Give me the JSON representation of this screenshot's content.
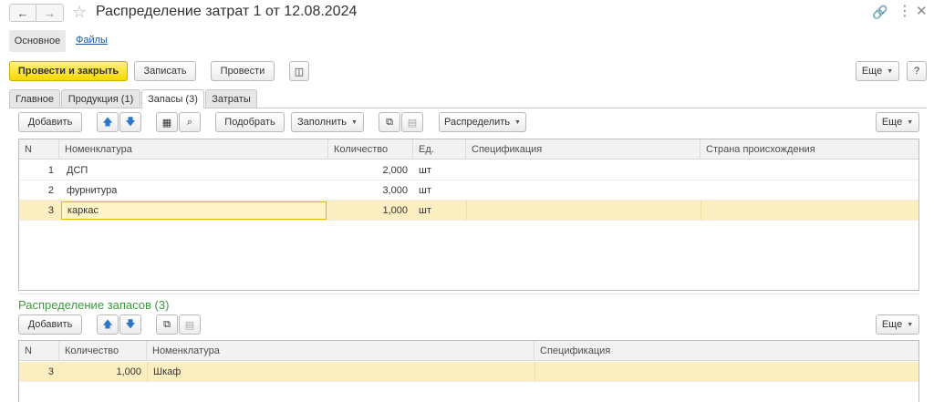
{
  "window": {
    "title": "Распределение затрат 1 от 12.08.2024",
    "icons": [
      "back-arrow-icon",
      "forward-arrow-icon",
      "star-icon",
      "link-icon",
      "more-vertical-icon",
      "close-icon"
    ]
  },
  "sections": {
    "main": "Основное",
    "files": "Файлы"
  },
  "toolbar": {
    "post_close": "Провести и закрыть",
    "save": "Записать",
    "post": "Провести",
    "more": "Еще",
    "help": "?"
  },
  "tabs": [
    "Главное",
    "Продукция (1)",
    "Запасы (3)",
    "Затраты"
  ],
  "stock_toolbar": {
    "add": "Добавить",
    "select": "Подобрать",
    "fill": "Заполнить",
    "distribute": "Распределить",
    "more": "Еще"
  },
  "stock_table": {
    "columns": [
      "N",
      "Номенклатура",
      "Количество",
      "Ед.",
      "Спецификация",
      "Страна происхождения"
    ],
    "rows": [
      {
        "n": "1",
        "item": "ДСП",
        "qty": "2,000",
        "unit": "шт"
      },
      {
        "n": "2",
        "item": "фурнитура",
        "qty": "3,000",
        "unit": "шт"
      },
      {
        "n": "3",
        "item": "каркас",
        "qty": "1,000",
        "unit": "шт"
      }
    ]
  },
  "dist": {
    "title": "Распределение запасов (3)",
    "add": "Добавить",
    "more": "Еще",
    "columns": [
      "N",
      "Количество",
      "Номенклатура",
      "Спецификация"
    ],
    "rows": [
      {
        "n": "3",
        "qty": "1,000",
        "item": "Шкаф"
      }
    ]
  },
  "colors": {
    "accent": "#f6d800",
    "selected_row": "#fbefc2",
    "link": "#1a5aa8",
    "section_title": "#3b9a3b"
  }
}
